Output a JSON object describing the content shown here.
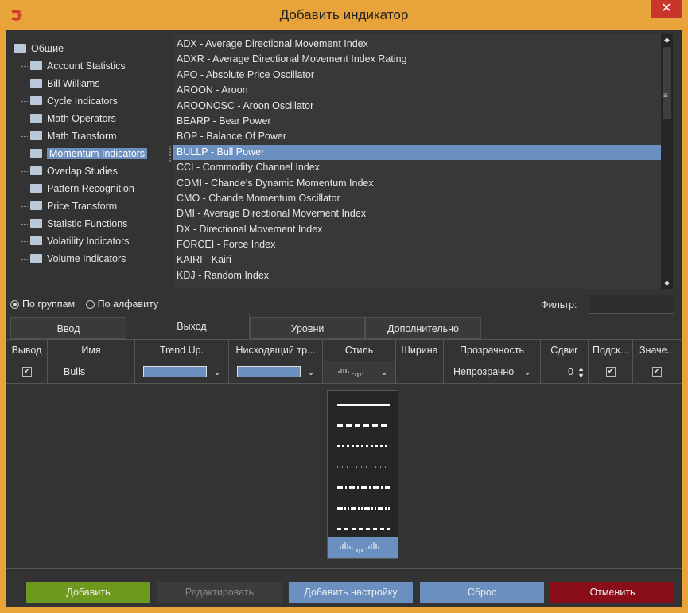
{
  "window": {
    "title": "Добавить индикатор",
    "close_glyph": "✕"
  },
  "tree": {
    "root": "Общие",
    "items": [
      "Account Statistics",
      "Bill Williams",
      "Cycle Indicators",
      "Math Operators",
      "Math Transform",
      "Momentum Indicators",
      "Overlap Studies",
      "Pattern Recognition",
      "Price Transform",
      "Statistic Functions",
      "Volatility Indicators",
      "Volume Indicators"
    ],
    "selected_index": 5
  },
  "indicators": {
    "items": [
      "ADX - Average Directional Movement Index",
      "ADXR - Average Directional Movement Index Rating",
      "APO - Absolute Price Oscillator",
      "AROON - Aroon",
      "AROONOSC - Aroon Oscillator",
      "BEARP - Bear Power",
      "BOP - Balance Of Power",
      "BULLP - Bull Power",
      "CCI - Commodity Channel Index",
      "CDMI - Chande's Dynamic Momentum Index",
      "CMO - Chande Momentum Oscillator",
      "DMI - Average Directional Movement Index",
      "DX - Directional Movement Index",
      "FORCEI - Force Index",
      "KAIRI - Kairi",
      "KDJ -  Random Index"
    ],
    "selected_index": 7
  },
  "grouping": {
    "by_group": "По группам",
    "by_alpha": "По алфавиту",
    "selected": "by_group"
  },
  "filter": {
    "label": "Фильтр:",
    "value": ""
  },
  "tabs": [
    {
      "label": "Ввод",
      "active": false
    },
    {
      "label": "Выход",
      "active": true
    },
    {
      "label": "Уровни",
      "active": false
    },
    {
      "label": "Дополнительно",
      "active": false
    }
  ],
  "grid": {
    "columns": [
      "Вывод",
      "Имя",
      "Trend Up.",
      "Нисходящий тр...",
      "Стиль",
      "Ширина",
      "Прозрачность",
      "Сдвиг",
      "Подск...",
      "Значе..."
    ],
    "row": {
      "output_checked": true,
      "name": "Bulls",
      "trend_up_color": "#6b8fbf",
      "trend_down_color": "#6b8fbf",
      "width": "",
      "transparency": "Непрозрачно",
      "shift": "0",
      "hint_checked": true,
      "value_checked": true
    }
  },
  "style_options": [
    "solid",
    "dash",
    "dot",
    "sparse-dot",
    "dash-dot",
    "dash-dot-dot",
    "long-dash",
    "histogram"
  ],
  "style_selected_index": 7,
  "buttons": {
    "add": "Добавить",
    "edit": "Редактировать",
    "add_setting": "Добавить настройку",
    "reset": "Сброс",
    "cancel": "Отменить"
  },
  "colors": {
    "accent_selection": "#6b8fbf",
    "title_bar": "#e8a33a",
    "add_button": "#6d9a1e",
    "cancel_button": "#8a0d1a"
  }
}
